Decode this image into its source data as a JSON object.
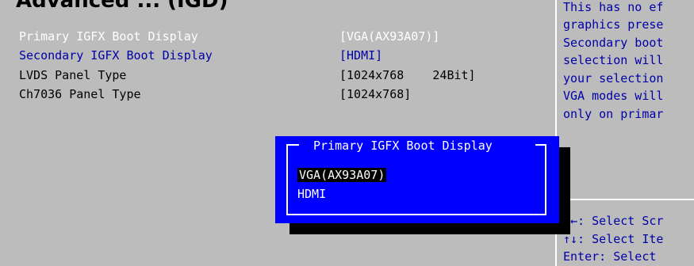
{
  "header": {
    "title": "Advanced    ...  (IGD)"
  },
  "settings": [
    {
      "label": "Primary IGFX Boot Display",
      "value": "[VGA(AX93A07)]"
    },
    {
      "label": "Secondary IGFX Boot Display",
      "value": "[HDMI]"
    },
    {
      "label": "LVDS Panel Type",
      "value": "[1024x768    24Bit]"
    },
    {
      "label": "Ch7036 Panel Type",
      "value": "[1024x768]"
    }
  ],
  "help": {
    "lines": [
      "This has no ef",
      "graphics prese",
      "Secondary boot",
      "selection will",
      "your selection",
      "VGA modes will",
      "only on primar"
    ],
    "keys": [
      "→←: Select Scr",
      "↑↓: Select Ite",
      "Enter: Select"
    ]
  },
  "popup": {
    "title": "Primary IGFX Boot Display",
    "options": [
      "VGA(AX93A07)",
      "HDMI"
    ],
    "selected": "VGA(AX93A07)"
  },
  "colors": {
    "background": "#bcbcbc",
    "popup": "#0000ff",
    "help_text": "#0000a8",
    "highlight_text": "#ffffff"
  }
}
